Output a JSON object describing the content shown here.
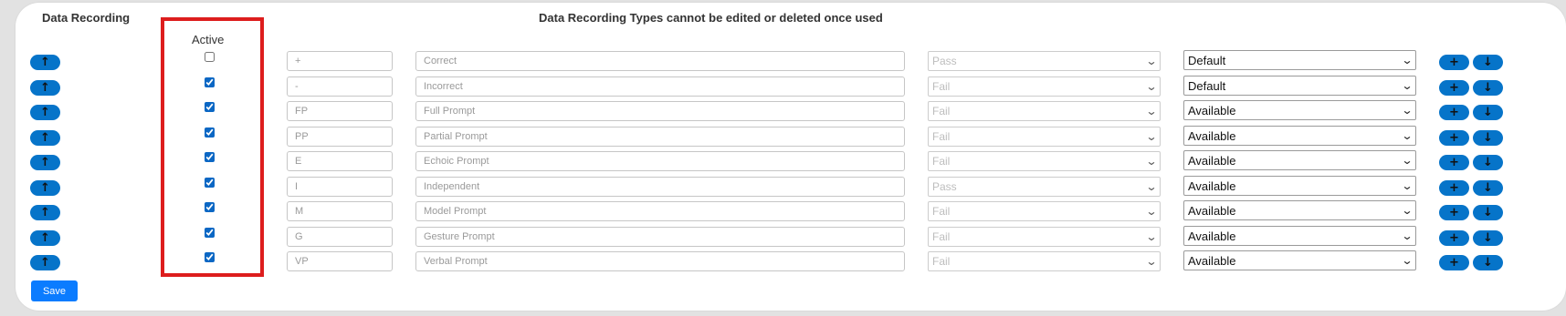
{
  "header": {
    "section_title": "Data Recording",
    "notice": "Data Recording Types cannot be edited or deleted once used",
    "active_column": "Active"
  },
  "icons": {
    "up": "↑",
    "down": "↓",
    "plus": "+",
    "chevron": "⌄"
  },
  "rows": [
    {
      "active": false,
      "code": "+",
      "name": "Correct",
      "result": "Pass",
      "status": "Default"
    },
    {
      "active": true,
      "code": "-",
      "name": "Incorrect",
      "result": "Fail",
      "status": "Default"
    },
    {
      "active": true,
      "code": "FP",
      "name": "Full Prompt",
      "result": "Fail",
      "status": "Available"
    },
    {
      "active": true,
      "code": "PP",
      "name": "Partial Prompt",
      "result": "Fail",
      "status": "Available"
    },
    {
      "active": true,
      "code": "E",
      "name": "Echoic Prompt",
      "result": "Fail",
      "status": "Available"
    },
    {
      "active": true,
      "code": "I",
      "name": "Independent",
      "result": "Pass",
      "status": "Available"
    },
    {
      "active": true,
      "code": "M",
      "name": "Model Prompt",
      "result": "Fail",
      "status": "Available"
    },
    {
      "active": true,
      "code": "G",
      "name": "Gesture Prompt",
      "result": "Fail",
      "status": "Available"
    },
    {
      "active": true,
      "code": "VP",
      "name": "Verbal Prompt",
      "result": "Fail",
      "status": "Available"
    }
  ],
  "actions": {
    "save_label": "Save"
  },
  "colors": {
    "pill_blue": "#0674c9",
    "save_blue": "#0b7cff",
    "highlight_red": "#dd1d1d"
  }
}
